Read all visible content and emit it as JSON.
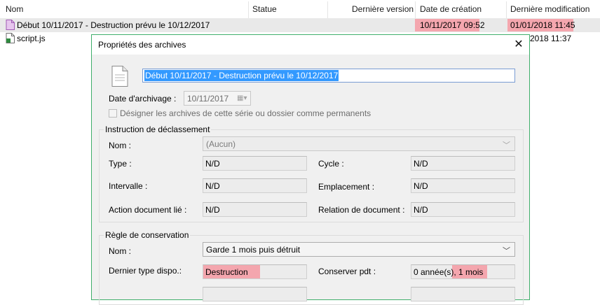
{
  "columns": {
    "name": "Nom",
    "status": "Statue",
    "version": "Dernière version",
    "created": "Date de création",
    "modified": "Dernière modification"
  },
  "files": [
    {
      "name": "Début 10/11/2017 - Destruction prévu le 10/12/2017",
      "created": "10/11/2017 09:52",
      "modified": "01/01/2018 11:45"
    },
    {
      "name": "script.js",
      "modified": "2018 11:37"
    }
  ],
  "dialog": {
    "title": "Propriétés des archives",
    "close": "✕",
    "name_value": "Début 10/11/2017 - Destruction prévu le 10/12/2017",
    "archive_date_label": "Date d'archivage :",
    "archive_date_value": "10/11/2017",
    "permanent_label": "Désigner les archives de cette série ou dossier comme permanents",
    "classification": {
      "title": "Instruction de déclassement",
      "name_label": "Nom :",
      "name_value": "(Aucun)",
      "type_label": "Type :",
      "type_value": "N/D",
      "cycle_label": "Cycle :",
      "cycle_value": "N/D",
      "interval_label": "Intervalle :",
      "interval_value": "N/D",
      "location_label": "Emplacement :",
      "location_value": "N/D",
      "action_label": "Action document lié :",
      "action_value": "N/D",
      "relation_label": "Relation de document :",
      "relation_value": "N/D"
    },
    "retention": {
      "title": "Règle de conservation",
      "name_label": "Nom :",
      "name_value": "Garde 1 mois puis détruit",
      "last_dispo_label": "Dernier type dispo.:",
      "last_dispo_value": "Destruction",
      "keep_label": "Conserver pdt :",
      "keep_years": "0 année(s),",
      "keep_months": "1 mois"
    }
  },
  "colors": {
    "highlight": "#f4a6ae",
    "selection": "#3399ff",
    "dialog_border": "#3fae6b"
  }
}
